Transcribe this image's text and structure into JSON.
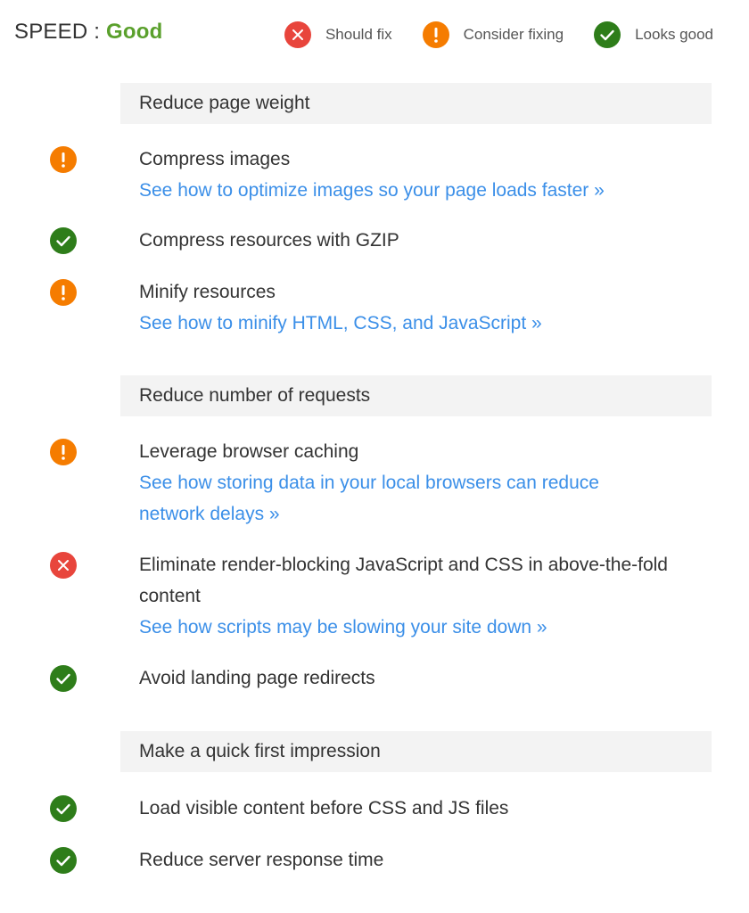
{
  "header": {
    "speed_label": "SPEED :",
    "speed_score": "Good"
  },
  "legend": [
    {
      "status": "bad",
      "icon": "x-circle-icon",
      "label": "Should fix"
    },
    {
      "status": "warn",
      "icon": "exclamation-circle-icon",
      "label": "Consider fixing"
    },
    {
      "status": "good",
      "icon": "check-circle-icon",
      "label": "Looks good"
    }
  ],
  "colors": {
    "should_fix": "#e8453c",
    "consider_fixing": "#f57c00",
    "looks_good": "#2e7d1a",
    "score_good": "#5aa02c",
    "link": "#3b8fe8",
    "section_bg": "#f3f3f3"
  },
  "sections": [
    {
      "title": "Reduce page weight",
      "rules": [
        {
          "status": "warn",
          "title": "Compress images",
          "link": "See how to optimize images so your page loads faster »"
        },
        {
          "status": "good",
          "title": "Compress resources with GZIP",
          "link": ""
        },
        {
          "status": "warn",
          "title": "Minify resources",
          "link": "See how to minify HTML, CSS, and JavaScript »"
        }
      ]
    },
    {
      "title": "Reduce number of requests",
      "rules": [
        {
          "status": "warn",
          "title": "Leverage browser caching",
          "link": "See how storing data in your local browsers can reduce network delays »"
        },
        {
          "status": "bad",
          "title": "Eliminate render-blocking JavaScript and CSS in above-the-fold content",
          "link": "See how scripts may be slowing your site down »"
        },
        {
          "status": "good",
          "title": "Avoid landing page redirects",
          "link": ""
        }
      ]
    },
    {
      "title": "Make a quick first impression",
      "rules": [
        {
          "status": "good",
          "title": "Load visible content before CSS and JS files",
          "link": ""
        },
        {
          "status": "good",
          "title": "Reduce server response time",
          "link": ""
        }
      ]
    }
  ]
}
